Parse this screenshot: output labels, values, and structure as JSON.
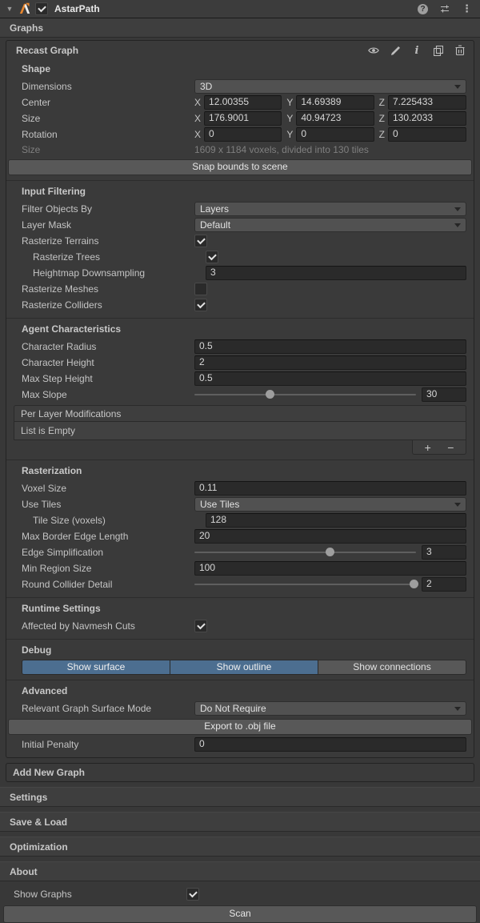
{
  "window": {
    "title": "AstarPath",
    "graphs_header": "Graphs",
    "add_new_graph": "Add New Graph",
    "bottom_sections": [
      "Settings",
      "Save & Load",
      "Optimization",
      "About"
    ],
    "show_graphs_label": "Show Graphs",
    "show_graphs_checked": true,
    "scan_button": "Scan"
  },
  "icons": {
    "foldout": "▼",
    "help": "?",
    "menu": "⋮",
    "info": "i",
    "plus": "+",
    "minus": "−"
  },
  "recast": {
    "title": "Recast Graph",
    "shape": {
      "header": "Shape",
      "axis": {
        "x": "X",
        "y": "Y",
        "z": "Z"
      },
      "dimensions_label": "Dimensions",
      "dimensions_value": "3D",
      "center_label": "Center",
      "center": {
        "x": "12.00355",
        "y": "14.69389",
        "z": "7.225433"
      },
      "size_label": "Size",
      "size": {
        "x": "176.9001",
        "y": "40.94723",
        "z": "130.2033"
      },
      "rotation_label": "Rotation",
      "rotation": {
        "x": "0",
        "y": "0",
        "z": "0"
      },
      "voxel_info_label": "Size",
      "voxel_info": "1609 x 1184 voxels, divided into 130 tiles",
      "snap_button": "Snap bounds to scene"
    },
    "input_filtering": {
      "header": "Input Filtering",
      "filter_by_label": "Filter Objects By",
      "filter_by_value": "Layers",
      "layer_mask_label": "Layer Mask",
      "layer_mask_value": "Default",
      "rasterize_terrains_label": "Rasterize Terrains",
      "rasterize_terrains": true,
      "rasterize_trees_label": "Rasterize Trees",
      "rasterize_trees": true,
      "heightmap_label": "Heightmap Downsampling",
      "heightmap_value": "3",
      "rasterize_meshes_label": "Rasterize Meshes",
      "rasterize_meshes": false,
      "rasterize_colliders_label": "Rasterize Colliders",
      "rasterize_colliders": true
    },
    "agent": {
      "header": "Agent Characteristics",
      "radius_label": "Character Radius",
      "radius_value": "0.5",
      "height_label": "Character Height",
      "height_value": "2",
      "step_label": "Max Step Height",
      "step_value": "0.5",
      "slope_label": "Max Slope",
      "slope_value": "30",
      "slope_pct": 34,
      "per_layer_header": "Per Layer Modifications",
      "list_empty": "List is Empty"
    },
    "rasterization": {
      "header": "Rasterization",
      "voxel_label": "Voxel Size",
      "voxel_value": "0.11",
      "use_tiles_label": "Use Tiles",
      "use_tiles_value": "Use Tiles",
      "tile_size_label": "Tile Size (voxels)",
      "tile_size_value": "128",
      "border_label": "Max Border Edge Length",
      "border_value": "20",
      "edge_label": "Edge Simplification",
      "edge_value": "3",
      "edge_pct": 61,
      "region_label": "Min Region Size",
      "region_value": "100",
      "collider_label": "Round Collider Detail",
      "collider_value": "2",
      "collider_pct": 99
    },
    "runtime": {
      "header": "Runtime Settings",
      "navmesh_cuts_label": "Affected by Navmesh Cuts",
      "navmesh_cuts": true
    },
    "debug": {
      "header": "Debug",
      "buttons": [
        {
          "label": "Show surface",
          "active": true
        },
        {
          "label": "Show outline",
          "active": true
        },
        {
          "label": "Show connections",
          "active": false
        }
      ]
    },
    "advanced": {
      "header": "Advanced",
      "surface_mode_label": "Relevant Graph Surface Mode",
      "surface_mode_value": "Do Not Require",
      "export_button": "Export to .obj file",
      "penalty_label": "Initial Penalty",
      "penalty_value": "0"
    }
  },
  "colors": {
    "accent_blue": "#4C6E90",
    "logo_orange": "#E8862E",
    "background": "#383838"
  }
}
